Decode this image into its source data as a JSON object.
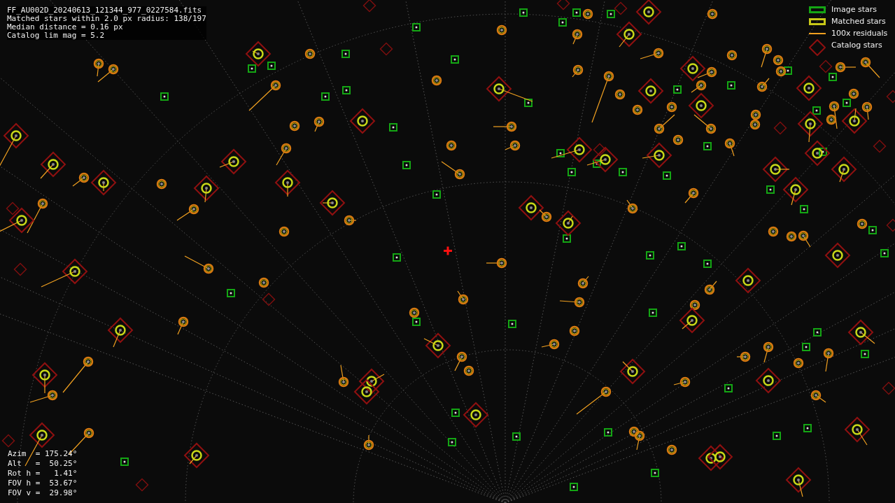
{
  "info_lines": [
    "FF_AU002D_20240613_121344_977_0227584.fits",
    "Matched stars within 2.0 px radius: 138/197",
    "Median distance = 0.16 px",
    "Catalog lim mag = 5.2"
  ],
  "legend": [
    {
      "kind": "image",
      "label": "Image stars"
    },
    {
      "kind": "matched",
      "label": "Matched stars"
    },
    {
      "kind": "residual",
      "label": "100x residuals"
    },
    {
      "kind": "catalog",
      "label": "Catalog stars"
    }
  ],
  "pointing": [
    {
      "label": "Azim  =",
      "value": "175.24°"
    },
    {
      "label": "Alt   =",
      "value": " 50.25°"
    },
    {
      "label": "Rot h =",
      "value": "  1.41°"
    },
    {
      "label": "FOV h =",
      "value": " 53.67°"
    },
    {
      "label": "FOV v =",
      "value": " 29.98°"
    }
  ]
}
